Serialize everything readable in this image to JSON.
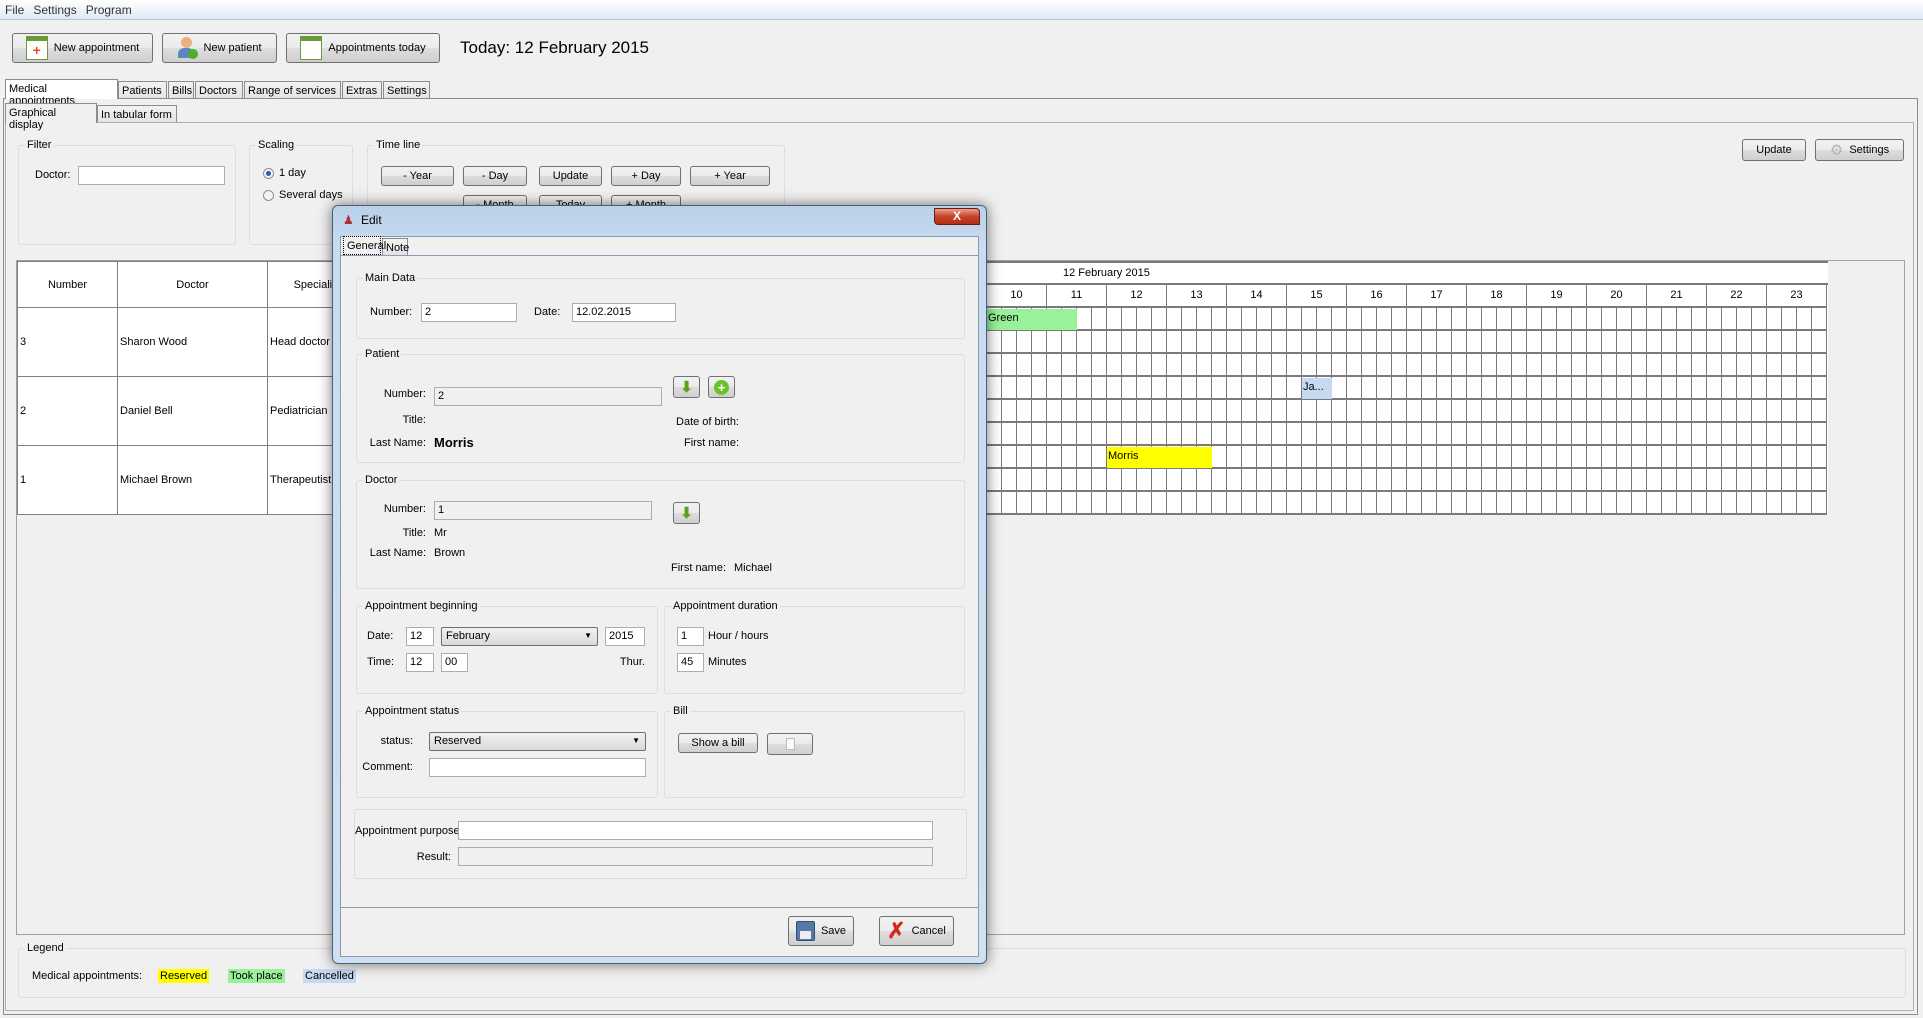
{
  "menu": [
    "File",
    "Settings",
    "Program"
  ],
  "toolbar": {
    "new_appointment": "New appointment",
    "new_patient": "New patient",
    "appointments_today": "Appointments today",
    "today": "Today: 12 February 2015"
  },
  "main_tabs": [
    "Medical appointments",
    "Patients",
    "Bills",
    "Doctors",
    "Range of services",
    "Extras",
    "Settings"
  ],
  "sub_tabs": [
    "Graphical display",
    "In tabular form"
  ],
  "filter": {
    "title": "Filter",
    "doctor_label": "Doctor:",
    "doctor_value": ""
  },
  "scaling": {
    "title": "Scaling",
    "options": [
      "1 day",
      "Several days"
    ],
    "selected": "1 day"
  },
  "timeline": {
    "title": "Time line",
    "row1": [
      "- Year",
      "- Day",
      "Update",
      "+ Day",
      "+ Year"
    ],
    "row2": [
      "- Month",
      "Today",
      "+ Month"
    ]
  },
  "right_buttons": {
    "update": "Update",
    "settings": "Settings"
  },
  "table": {
    "headers": [
      "Number",
      "Doctor",
      "Specialisation"
    ],
    "rows": [
      [
        "3",
        "Sharon Wood",
        "Head doctor"
      ],
      [
        "2",
        "Daniel Bell",
        "Pediatrician"
      ],
      [
        "1",
        "Michael Brown",
        "Therapeutist"
      ]
    ]
  },
  "schedule": {
    "date": "12 February 2015",
    "hours": [
      "10",
      "11",
      "12",
      "13",
      "14",
      "15",
      "16",
      "17",
      "18",
      "19",
      "20",
      "21",
      "22",
      "23"
    ],
    "appointments": [
      {
        "label": "Green",
        "doctor": "Sharon Wood",
        "lane": 0,
        "start": "10:00",
        "end": "11:30",
        "status": "took_place"
      },
      {
        "label": "Ja...",
        "doctor": "Daniel Bell",
        "lane": 0,
        "start": "15:15",
        "end": "15:45",
        "status": "cancelled"
      },
      {
        "label": "Morris",
        "doctor": "Michael Brown",
        "lane": 0,
        "start": "12:00",
        "end": "13:45",
        "status": "reserved"
      }
    ]
  },
  "status_colors": {
    "reserved": "#ffff00",
    "took_place": "#99f299",
    "cancelled": "#c6d9f1"
  },
  "legend": {
    "title": "Legend",
    "label": "Medical appointments:",
    "items": [
      "Reserved",
      "Took place",
      "Cancelled"
    ]
  },
  "dialog": {
    "title": "Edit",
    "close": "X",
    "tabs": [
      "General",
      "Note"
    ],
    "main_data": {
      "title": "Main Data",
      "number_label": "Number:",
      "number": "2",
      "date_label": "Date:",
      "date": "12.02.2015"
    },
    "patient": {
      "title": "Patient",
      "number_label": "Number:",
      "number": "2",
      "title_label": "Title:",
      "last_name_label": "Last Name:",
      "last_name": "Morris",
      "dob_label": "Date of birth:",
      "first_name_label": "First name:"
    },
    "doctor": {
      "title": "Doctor",
      "number_label": "Number:",
      "number": "1",
      "title_label": "Title:",
      "title_value": "Mr",
      "last_name_label": "Last Name:",
      "last_name": "Brown",
      "first_name_label": "First name:",
      "first_name": "Michael"
    },
    "beginning": {
      "title": "Appointment beginning",
      "date_label": "Date:",
      "day": "12",
      "month": "February",
      "year": "2015",
      "time_label": "Time:",
      "hour": "12",
      "minute": "00",
      "weekday": "Thur."
    },
    "duration": {
      "title": "Appointment duration",
      "hours": "1",
      "hours_label": "Hour / hours",
      "minutes": "45",
      "minutes_label": "Minutes"
    },
    "status": {
      "title": "Appointment status",
      "status_label": "status:",
      "status": "Reserved",
      "comment_label": "Comment:",
      "comment": ""
    },
    "bill": {
      "title": "Bill",
      "show_bill": "Show a bill"
    },
    "purpose_label": "Appointment purpose:",
    "purpose": "",
    "result_label": "Result:",
    "result": "",
    "save": "Save",
    "cancel": "Cancel"
  }
}
